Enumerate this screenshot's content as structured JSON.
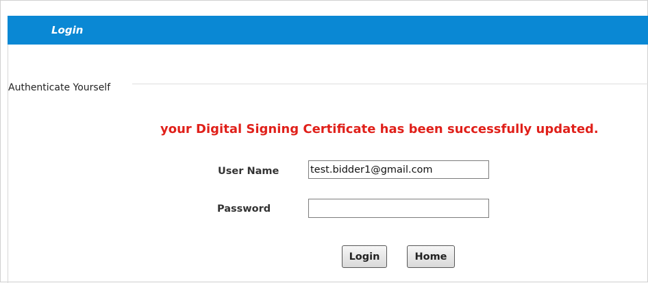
{
  "header": {
    "title": "Login"
  },
  "fieldset": {
    "legend": "Authenticate Yourself"
  },
  "message": {
    "text": "your Digital Signing Certificate has been successfully updated.",
    "color": "#e0201a"
  },
  "form": {
    "username_label": "User Name",
    "username_value": "test.bidder1@gmail.com",
    "password_label": "Password",
    "password_value": ""
  },
  "buttons": {
    "login_label": "Login",
    "home_label": "Home"
  },
  "colors": {
    "header_bg": "#0a88d4",
    "header_text": "#ffffff"
  }
}
